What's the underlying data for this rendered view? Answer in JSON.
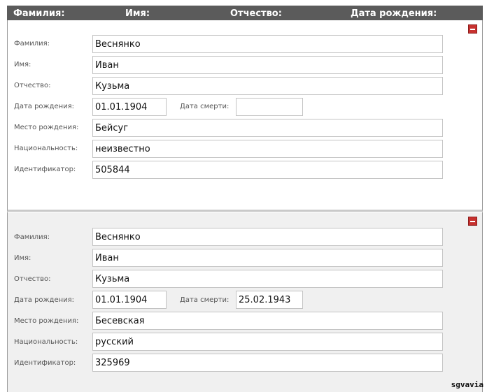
{
  "header": {
    "col_surname": "Фамилия:",
    "col_name": "Имя:",
    "col_patronymic": "Отчество:",
    "col_birthdate": "Дата рождения:"
  },
  "labels": {
    "surname": "Фамилия:",
    "name": "Имя:",
    "patronymic": "Отчество:",
    "birth_date": "Дата рождения:",
    "death_date": "Дата смерти:",
    "birth_place": "Место рождения:",
    "nationality": "Национальность:",
    "identifier": "Идентификатор:"
  },
  "records": [
    {
      "surname": "Веснянко",
      "name": "Иван",
      "patronymic": "Кузьма",
      "birth_date": "01.01.1904",
      "death_date": "",
      "birth_place": "Бейсуг",
      "nationality": "неизвестно",
      "identifier": "505844"
    },
    {
      "surname": "Веснянко",
      "name": "Иван",
      "patronymic": "Кузьма",
      "birth_date": "01.01.1904",
      "death_date": "25.02.1943",
      "birth_place": "Бесевская",
      "nationality": "русский",
      "identifier": "325969"
    }
  ],
  "watermark": "sgvavia",
  "colors": {
    "header_bg": "#5b5b5b",
    "remove_button": "#c7312f",
    "card2_bg": "#f0f0f0"
  }
}
